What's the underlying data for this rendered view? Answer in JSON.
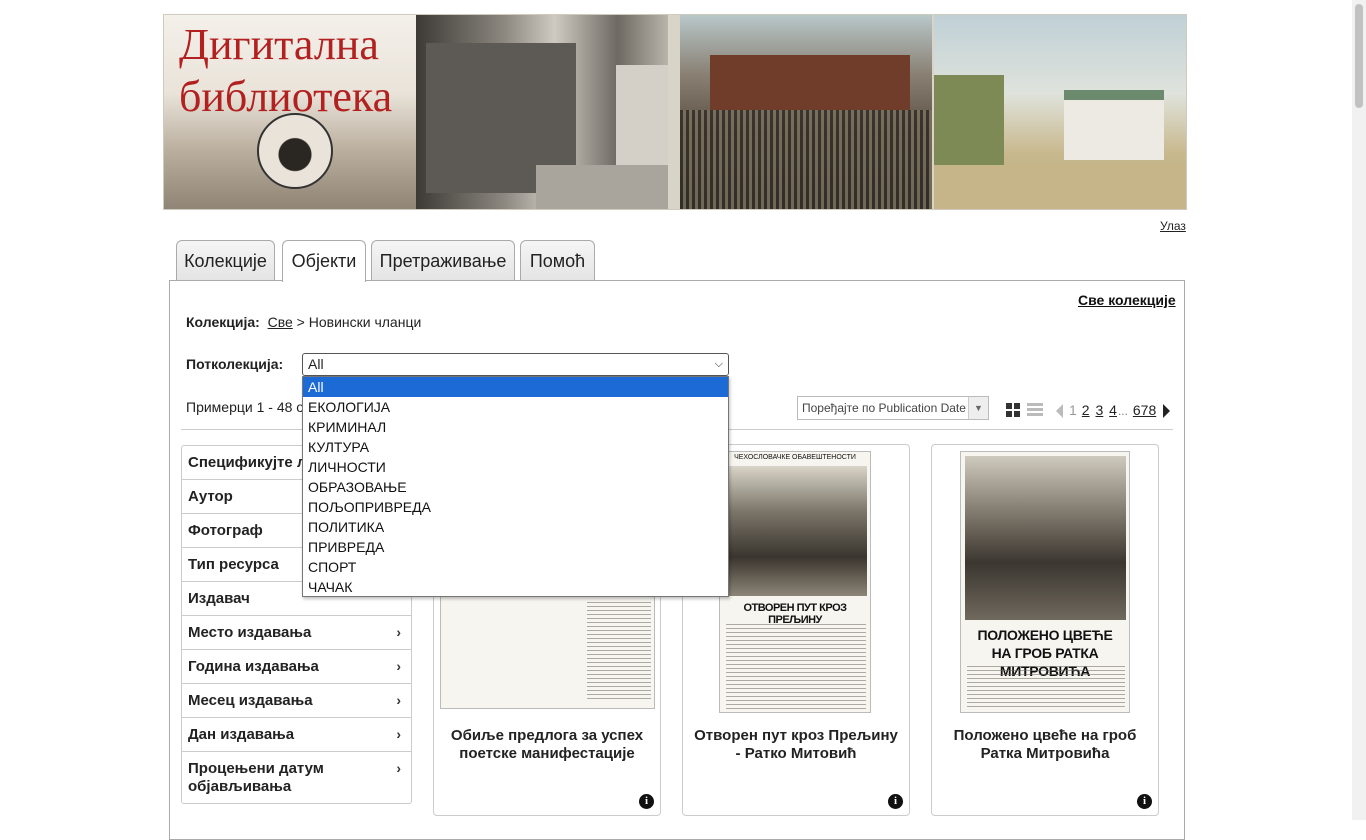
{
  "banner": {
    "title_line1": "Дигитална",
    "title_line2": "библиотека"
  },
  "header": {
    "login": "Улаз"
  },
  "tabs": [
    {
      "label": "Колекције",
      "active": false
    },
    {
      "label": "Објекти",
      "active": true
    },
    {
      "label": "Претраживање",
      "active": false
    },
    {
      "label": "Помоћ",
      "active": false
    }
  ],
  "collection": {
    "label": "Колекција:",
    "root_link": "Све",
    "separator": ">",
    "current": "Новински чланци",
    "all_collections": "Све колекције"
  },
  "subcollection": {
    "label": "Потколекција:",
    "selected": "All",
    "options": [
      "All",
      "ЕКОЛОГИЈА",
      "КРИМИНАЛ",
      "КУЛТУРА",
      "ЛИЧНОСТИ",
      "ОБРАЗОВАЊЕ",
      "ПОЉОПРИВРЕДА",
      "ПОЛИТИКА",
      "ПРИВРЕДА",
      "СПОРТ",
      "ЧАЧАК"
    ]
  },
  "results": {
    "text": "Примерци 1 - 48 од"
  },
  "sort": {
    "label": "Поређајте по Publication Date"
  },
  "pagination": {
    "current": "1",
    "pages": [
      "2",
      "3",
      "4"
    ],
    "ellipsis": "...",
    "last": "678"
  },
  "facets": [
    {
      "label": "Спецификујте л",
      "has_chevron": false
    },
    {
      "label": "Аутор",
      "has_chevron": false
    },
    {
      "label": "Фотограф",
      "has_chevron": false
    },
    {
      "label": "Тип ресурса",
      "has_chevron": false
    },
    {
      "label": "Издавач",
      "has_chevron": false
    },
    {
      "label": "Место издавања",
      "has_chevron": true
    },
    {
      "label": "Година издавања",
      "has_chevron": true
    },
    {
      "label": "Месец издавања",
      "has_chevron": true
    },
    {
      "label": "Дан издавања",
      "has_chevron": true
    },
    {
      "label": "Процењени датум објављивања",
      "has_chevron": true
    }
  ],
  "items": [
    {
      "title": "Обиље предлога за успех поетске манифестације"
    },
    {
      "title": "Отворен пут кроз Прељину - Ратко Митовић",
      "kicker": "ЧЕХОСЛОВАЧКЕ ОБАВЕШТЕНОСТИ",
      "headline": "ОТВОРЕН ПУТ КРОЗ ПРЕЉИНУ"
    },
    {
      "title": "Положено цвеће на гроб Ратка Митровића",
      "headline": "ПОЛОЖЕНО ЦВЕЋЕ НА ГРОБ РАТКА МИТРОВИЋА"
    }
  ],
  "icons": {
    "chevron": "chevron-right-icon",
    "info": "info-icon",
    "grid_view": "grid-view-icon",
    "list_view": "list-view-icon"
  },
  "colors": {
    "selected_option": "#1b6ad6",
    "banner_title": "#b22020"
  }
}
